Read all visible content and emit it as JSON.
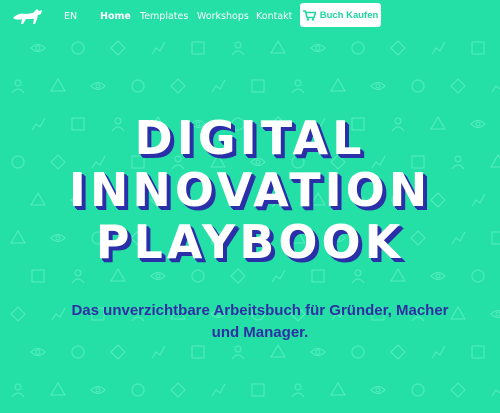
{
  "colors": {
    "background": "#24e0a6",
    "title_shadow": "#2b2fa8",
    "subtitle": "#2f2fa4",
    "nav_text": "#ffffff",
    "button_bg": "#ffffff",
    "button_text": "#1fd6a0"
  },
  "nav": {
    "logo_icon": "horse-icon",
    "language": "EN",
    "items": [
      {
        "label": "Home",
        "active": true
      },
      {
        "label": "Templates",
        "active": false
      },
      {
        "label": "Workshops",
        "active": false
      },
      {
        "label": "Kontakt",
        "active": false
      }
    ],
    "buy_button": {
      "icon": "cart-icon",
      "label": "Buch Kaufen"
    }
  },
  "hero": {
    "title_lines": [
      "DIGITAL",
      "INNOVATION",
      "PLAYBOOK"
    ],
    "subtitle": "Das unverzichtbare Arbeitsbuch für Gründer, Macher und Manager."
  }
}
